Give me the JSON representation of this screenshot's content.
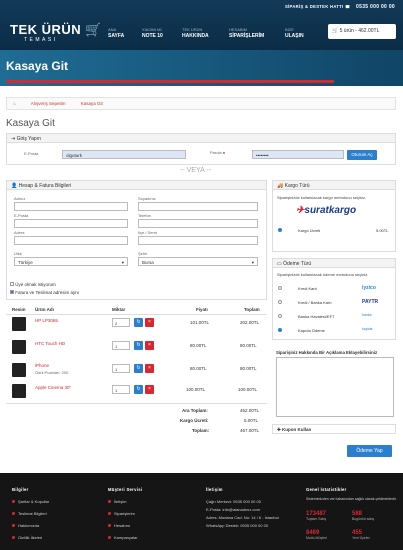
{
  "header": {
    "support_label": "SİPARİŞ & DESTEK HATTI",
    "phone": "0535 000 00 00",
    "logo": "TEK ÜRÜN",
    "logo_sub": "TEMASI",
    "nav": [
      {
        "top": "ANA",
        "bottom": "SAYFA"
      },
      {
        "top": "XIAOMI Mİ",
        "bottom": "NOTE 10"
      },
      {
        "top": "TEK ÜRÜN",
        "bottom": "HAKKINDA"
      },
      {
        "top": "HESABIM",
        "bottom": "SİPARİŞLERİM"
      },
      {
        "top": "BİZE",
        "bottom": "ULAŞIN"
      }
    ],
    "cart": "5 ürün - 462.00TL"
  },
  "banner": {
    "title": "Kasaya Git"
  },
  "breadcrumb": [
    "Alışveriş Sepetim",
    "Kasaya Git"
  ],
  "page_title": "Kasaya Git",
  "login": {
    "title": "Giriş Yapın",
    "email_label": "E-Posta",
    "email_value": "olguturk",
    "password_label": "Parola",
    "password_value": "••••••••",
    "button": "Oturum Aç"
  },
  "or_text": "-- VEYA --",
  "address": {
    "title": "Hesap & Fatura Bilgileri",
    "name": "Adınız",
    "surname": "Soyadınız",
    "email": "E-Posta",
    "phone": "Telefon",
    "address": "Adres",
    "zip": "Ilçe / Semt",
    "country_label": "Ülke",
    "country_value": "Türkiye",
    "city_label": "Şehir",
    "city_value": "Bursa",
    "member_check": "Üye olmak istiyorum",
    "invoice_check": "Fatura ve Teslimat adresim aynı"
  },
  "cart_table": {
    "headers": [
      "Resim",
      "Ürün Adı",
      "Miktar",
      "Fiyatı",
      "Toplam"
    ],
    "rows": [
      {
        "name": "HP LP3065",
        "sub": "",
        "qty": "2",
        "price": "101.00TL",
        "total": "202.00TL"
      },
      {
        "name": "HTC Touch HD",
        "sub": "",
        "qty": "1",
        "price": "80.00TL",
        "total": "80.00TL"
      },
      {
        "name": "iPhone",
        "sub": "Ödül Puanları: 200",
        "qty": "1",
        "price": "80.00TL",
        "total": "80.00TL"
      },
      {
        "name": "Apple Cinema 30\"",
        "sub": "",
        "qty": "1",
        "price": "100.00TL",
        "total": "100.00TL"
      }
    ],
    "subtotal_label": "Ara Toplam:",
    "subtotal": "462.00TL",
    "shipping_label": "Kargo Ücreti:",
    "shipping": "5.00TL",
    "total_label": "Toplam:",
    "total": "467.00TL"
  },
  "shipping": {
    "title": "Kargo Türü",
    "desc": "Siparişinizde kullanılacak kargo metodunu seçiniz.",
    "brand": "suratkargo",
    "option": "Kargo Ücreti",
    "price": "5.00TL"
  },
  "payment": {
    "title": "Ödeme Türü",
    "desc": "Siparişinizde kullanılacak ödeme metodunu seçiniz.",
    "methods": [
      {
        "name": "Kredi Kartı",
        "logo": "iyzico"
      },
      {
        "name": "Kredi / Banka Kartı",
        "logo": "PAYTR"
      },
      {
        "name": "Banka Havalesi/EFT",
        "logo": "banka"
      },
      {
        "name": "Kapıda Ödeme",
        "logo": "kapıda"
      }
    ]
  },
  "note": {
    "title": "Siparişiniz Hakkında Bir Açıklama Eklayebilirsiniz"
  },
  "coupon": {
    "title": "Kupon Kullan"
  },
  "confirm": "Ödeme Yap",
  "footer": {
    "col1": {
      "title": "Bilgiler",
      "items": [
        "Şartlar & Koşullar",
        "Teslimat Bilgileri",
        "Hakkımızda",
        "Gizlilik İlkeleri"
      ]
    },
    "col2": {
      "title": "Müşteri Servisi",
      "items": [
        "İletişim",
        "Siparişlerim",
        "Hesabım",
        "Kampanyalar"
      ]
    },
    "col3": {
      "title": "İletişim",
      "lines": [
        "Çağrı Merkezi: 0535 000 00 00",
        "E-Posta: info@alanadınız.com",
        "Adres: Modana Cad. No: 14 / 6 - İstanbul",
        "WhatsApp Destek: 0535 000 00 00"
      ]
    },
    "col4": {
      "title": "Genel İstatistikler",
      "desc": "Sistemimizden veri tabanından sağlık olarak çekilmektedir.",
      "stats": [
        {
          "n": "173487",
          "l": "Toplam Satış"
        },
        {
          "n": "588",
          "l": "Bugünkü satış"
        },
        {
          "n": "8469",
          "l": "Mutlu Müşteri"
        },
        {
          "n": "455",
          "l": "Yeni Üyeler"
        }
      ]
    }
  },
  "colors": {
    "accent": "#d9262f",
    "primary": "#2b7fcf",
    "header": "#0b2c46"
  }
}
